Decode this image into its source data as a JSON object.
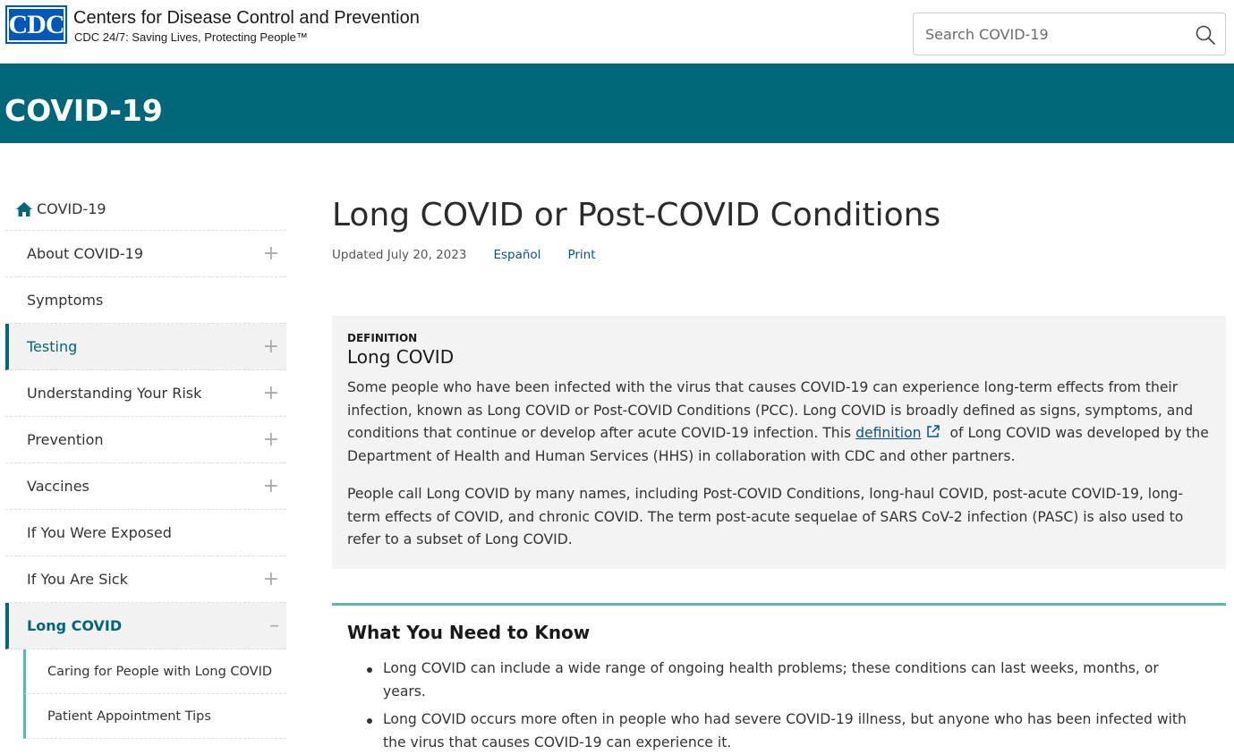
{
  "header": {
    "logo_text": "CDC",
    "org_name": "Centers for Disease Control and Prevention",
    "tagline": "CDC 24/7: Saving Lives, Protecting People™",
    "search_placeholder": "Search COVID-19"
  },
  "banner": {
    "title": "COVID-19"
  },
  "sidebar": {
    "home_label": "COVID-19",
    "items": [
      {
        "label": "About COVID-19",
        "toggle": "+"
      },
      {
        "label": "Symptoms",
        "toggle": ""
      },
      {
        "label": "Testing",
        "toggle": "+"
      },
      {
        "label": "Understanding Your Risk",
        "toggle": "+"
      },
      {
        "label": "Prevention",
        "toggle": "+"
      },
      {
        "label": "Vaccines",
        "toggle": "+"
      },
      {
        "label": "If You Were Exposed",
        "toggle": ""
      },
      {
        "label": "If You Are Sick",
        "toggle": "+"
      },
      {
        "label": "Long COVID",
        "toggle": "–"
      }
    ],
    "subitems": [
      {
        "label": "Caring for People with Long COVID"
      },
      {
        "label": "Patient Appointment Tips"
      }
    ]
  },
  "main": {
    "title": "Long COVID or Post-COVID Conditions",
    "updated": "Updated July 20, 2023",
    "espanol": "Español",
    "print": "Print",
    "definition": {
      "label": "DEFINITION",
      "title": "Long COVID",
      "para1_before": "Some people who have been infected with the virus that causes COVID-19 can experience long-term effects from their infection, known as Long COVID or Post-COVID Conditions (PCC). Long COVID is broadly defined as signs, symptoms, and conditions that continue or develop after acute COVID-19 infection. This ",
      "para1_link": "definition",
      "para1_after": " of Long COVID was developed by the Department of Health and Human Services (HHS) in collaboration with CDC and other partners.",
      "para2": "People call Long COVID by many names, including Post-COVID Conditions, long-haul COVID, post-acute COVID-19, long-term effects of COVID, and chronic COVID. The term post-acute sequelae of SARS CoV-2 infection (PASC) is also used to refer to a subset of Long COVID."
    },
    "know": {
      "title": "What You Need to Know",
      "bullets": [
        "Long COVID can include a wide range of ongoing health problems; these conditions can last weeks, months, or years.",
        "Long COVID occurs more often in people who had severe COVID-19 illness, but anyone who has been infected with the virus that causes COVID-19 can experience it."
      ]
    }
  },
  "colors": {
    "banner": "#006778",
    "accent": "#5fb3b3",
    "link": "#075290",
    "logo": "#0057b7"
  }
}
